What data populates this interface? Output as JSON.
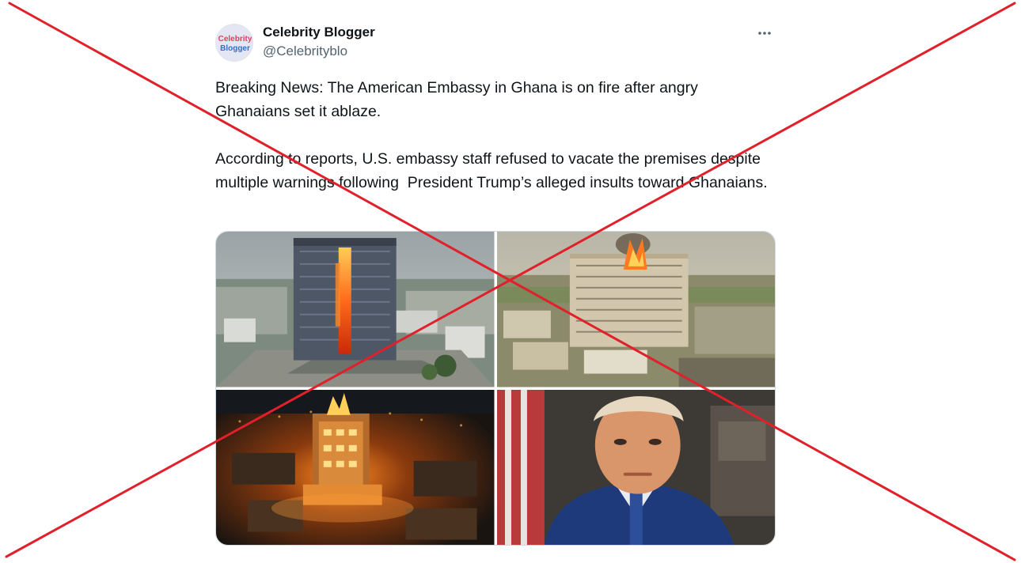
{
  "tweet": {
    "author_name": "Celebrity Blogger",
    "author_handle": "@Celebrityblo",
    "avatar_text_1": "Celebrity",
    "avatar_text_2": "Blogger",
    "paragraph_1": "Breaking News: The American Embassy in Ghana is on fire after angry Ghanaians set it ablaze.",
    "paragraph_2": "According to reports, U.S. embassy staff refused to vacate the premises despite multiple warnings following  President Trump’s alleged insults toward Ghanaians.",
    "more_icon": "more-horizontal-icon"
  },
  "media": {
    "images": [
      {
        "subject": "building-on-fire-daytime"
      },
      {
        "subject": "aerial-building-fire"
      },
      {
        "subject": "building-on-fire-night"
      },
      {
        "subject": "portrait-man-suit"
      }
    ]
  },
  "overlay": {
    "mark": "red-x-cross",
    "color": "#e0202a"
  },
  "colors": {
    "text_primary": "#0f1419",
    "text_secondary": "#536471",
    "border": "#cfd9de"
  }
}
